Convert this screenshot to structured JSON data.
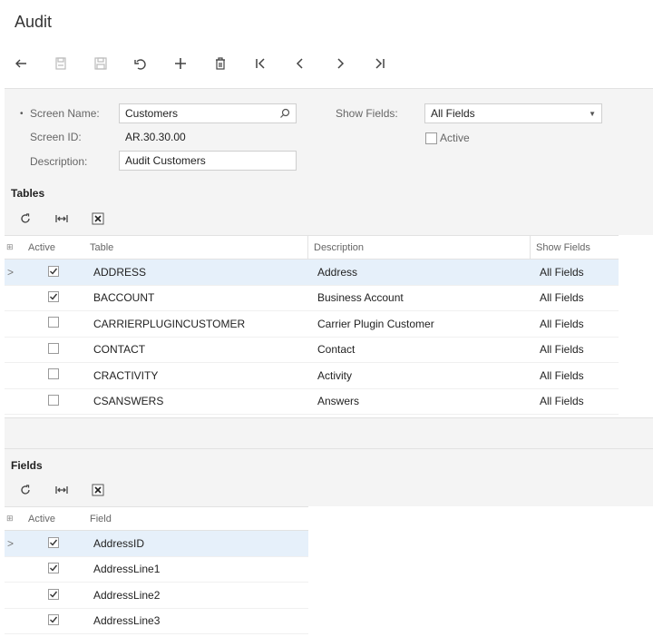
{
  "page": {
    "title": "Audit"
  },
  "toolbar": {
    "buttons": [
      {
        "name": "back",
        "icon": "back-arrow-icon"
      },
      {
        "name": "save-close",
        "icon": "save-close-icon"
      },
      {
        "name": "save",
        "icon": "save-icon"
      },
      {
        "name": "cancel",
        "icon": "undo-icon"
      },
      {
        "name": "add",
        "icon": "plus-icon"
      },
      {
        "name": "delete",
        "icon": "trash-icon"
      },
      {
        "name": "first",
        "icon": "first-icon"
      },
      {
        "name": "previous",
        "icon": "previous-icon"
      },
      {
        "name": "next",
        "icon": "next-icon"
      },
      {
        "name": "last",
        "icon": "last-icon"
      }
    ]
  },
  "summary": {
    "screen_name_label": "Screen Name:",
    "screen_name_required": "•",
    "screen_name_value": "Customers",
    "screen_id_label": "Screen ID:",
    "screen_id_value": "AR.30.30.00",
    "description_label": "Description:",
    "description_value": "Audit Customers",
    "show_fields_label": "Show Fields:",
    "show_fields_value": "All Fields",
    "active_label": "Active",
    "active_checked": false
  },
  "tables": {
    "title": "Tables",
    "columns": {
      "active": "Active",
      "table": "Table",
      "description": "Description",
      "show_fields": "Show Fields"
    },
    "rows": [
      {
        "active": true,
        "table": "ADDRESS",
        "description": "Address",
        "show_fields": "All Fields",
        "selected": true
      },
      {
        "active": true,
        "table": "BACCOUNT",
        "description": "Business Account",
        "show_fields": "All Fields",
        "selected": false
      },
      {
        "active": false,
        "table": "CARRIERPLUGINCUSTOMER",
        "description": "Carrier Plugin Customer",
        "show_fields": "All Fields",
        "selected": false
      },
      {
        "active": false,
        "table": "CONTACT",
        "description": "Contact",
        "show_fields": "All Fields",
        "selected": false
      },
      {
        "active": false,
        "table": "CRACTIVITY",
        "description": "Activity",
        "show_fields": "All Fields",
        "selected": false
      },
      {
        "active": false,
        "table": "CSANSWERS",
        "description": "Answers",
        "show_fields": "All Fields",
        "selected": false
      }
    ]
  },
  "fields": {
    "title": "Fields",
    "columns": {
      "active": "Active",
      "field": "Field"
    },
    "rows": [
      {
        "active": true,
        "field": "AddressID",
        "selected": true
      },
      {
        "active": true,
        "field": "AddressLine1",
        "selected": false
      },
      {
        "active": true,
        "field": "AddressLine2",
        "selected": false
      },
      {
        "active": true,
        "field": "AddressLine3",
        "selected": false
      }
    ]
  },
  "row_indicator": ">"
}
